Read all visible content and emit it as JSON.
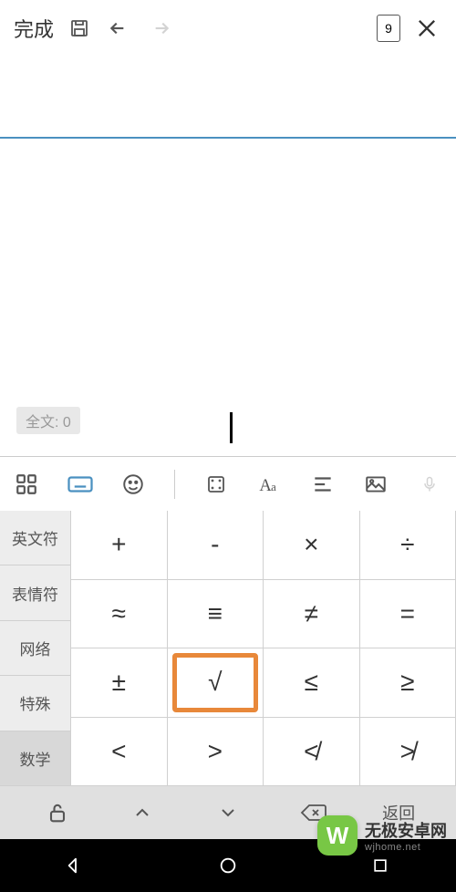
{
  "toolbar": {
    "done_label": "完成",
    "page_number": "9"
  },
  "editor": {
    "word_count_label": "全文: 0"
  },
  "keyboard": {
    "categories": [
      "英文符",
      "表情符",
      "网络",
      "特殊",
      "数学"
    ],
    "active_category_index": 4,
    "symbols": [
      "+",
      "-",
      "×",
      "÷",
      "≈",
      "≡",
      "≠",
      "=",
      "±",
      "√",
      "≤",
      "≥",
      "<",
      ">",
      "≮",
      "≯"
    ],
    "highlighted_index": 9,
    "return_label": "返回"
  },
  "watermark": {
    "logo": "W",
    "title": "无极安卓网",
    "subtitle": "wjhome.net"
  }
}
